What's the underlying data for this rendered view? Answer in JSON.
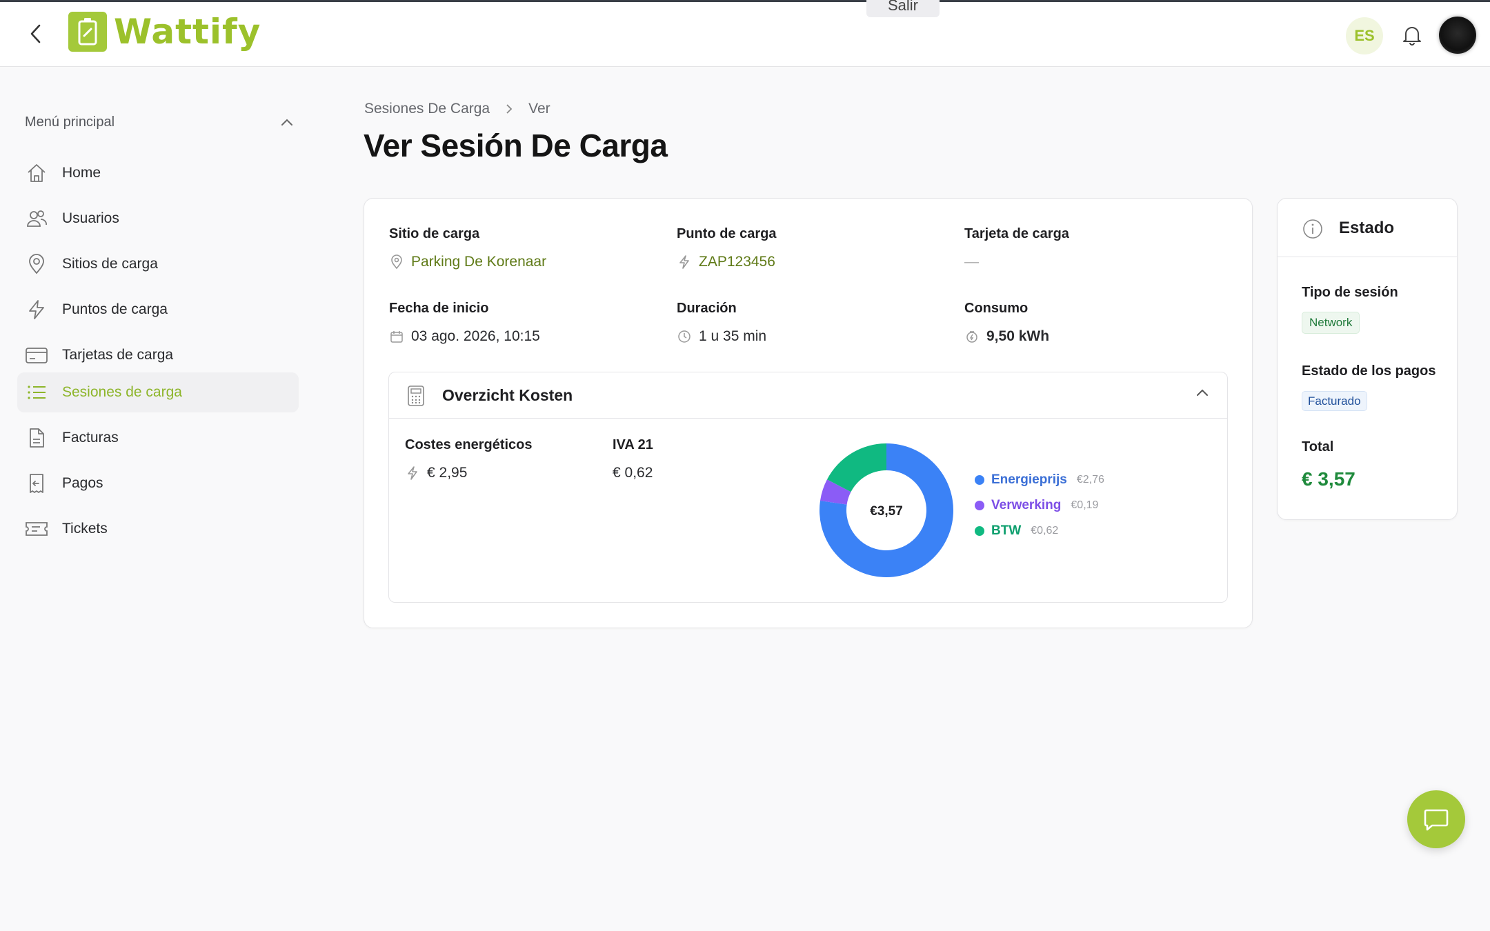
{
  "app": {
    "name": "Wattify",
    "language_badge": "ES",
    "top_banner_text": "Salir"
  },
  "colors": {
    "brand": "#a4c93a",
    "accent_text": "#8db52a",
    "total_green": "#1f8a3c"
  },
  "sidebar": {
    "menu_title": "Menú principal",
    "items": [
      {
        "label": "Home",
        "icon": "home-icon"
      },
      {
        "label": "Usuarios",
        "icon": "users-icon"
      },
      {
        "label": "Sitios de carga",
        "icon": "map-pin-icon"
      },
      {
        "label": "Puntos de carga",
        "icon": "lightning-icon"
      },
      {
        "label": "Tarjetas de carga",
        "icon": "card-icon"
      },
      {
        "label": "Sesiones de carga",
        "icon": "list-icon",
        "active": true
      },
      {
        "label": "Facturas",
        "icon": "document-icon"
      },
      {
        "label": "Pagos",
        "icon": "receipt-icon"
      },
      {
        "label": "Tickets",
        "icon": "ticket-icon"
      }
    ]
  },
  "breadcrumb": {
    "parent": "Sesiones De Carga",
    "current": "Ver"
  },
  "page_title": "Ver Sesión De Carga",
  "session": {
    "site_label": "Sitio de carga",
    "site_value": "Parking De Korenaar",
    "point_label": "Punto de carga",
    "point_value": "ZAP123456",
    "card_label": "Tarjeta de carga",
    "card_value": "—",
    "start_label": "Fecha de inicio",
    "start_value": "03 ago. 2026, 10:15",
    "duration_label": "Duración",
    "duration_value": "1 u 35 min",
    "consumption_label": "Consumo",
    "consumption_value": "9,50 kWh"
  },
  "costs": {
    "title": "Overzicht Kosten",
    "energy_label": "Costes energéticos",
    "energy_value": "€ 2,95",
    "vat_label": "IVA 21",
    "vat_value": "€ 0,62",
    "donut_center": "€3,57",
    "legend": [
      {
        "label": "Energieprijs",
        "value": "€2,76",
        "amount": 2.76,
        "color": "#3b82f6"
      },
      {
        "label": "Verwerking",
        "value": "€0,19",
        "amount": 0.19,
        "color": "#8b5cf6"
      },
      {
        "label": "BTW",
        "value": "€0,62",
        "amount": 0.62,
        "color": "#10b981"
      }
    ]
  },
  "status": {
    "title": "Estado",
    "session_type_label": "Tipo de sesión",
    "session_type_value": "Network",
    "payment_label": "Estado de los pagos",
    "payment_value": "Facturado",
    "total_label": "Total",
    "total_value": "€ 3,57"
  }
}
